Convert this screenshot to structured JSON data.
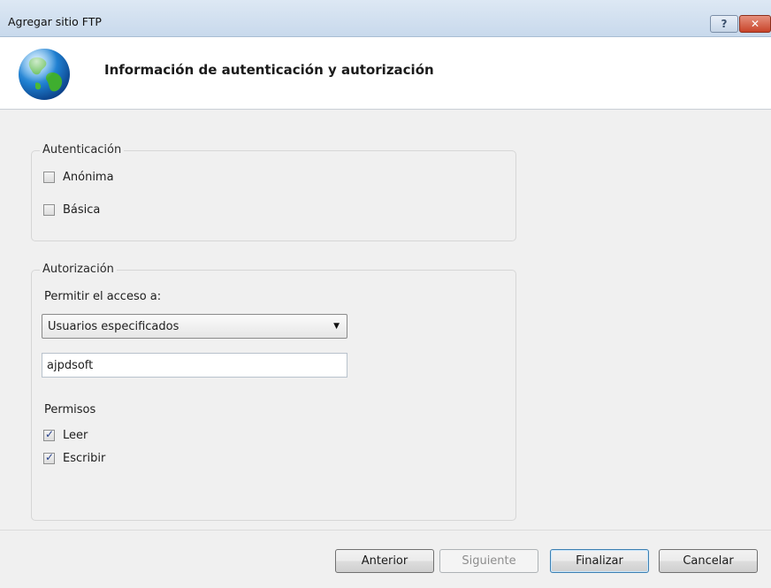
{
  "window": {
    "title": "Agregar sitio FTP",
    "help_label": "?",
    "close_label": "✕"
  },
  "header": {
    "title": "Información de autenticación y autorización",
    "icon": "globe-icon"
  },
  "authentication": {
    "legend": "Autenticación",
    "options": [
      {
        "label": "Anónima",
        "checked": false
      },
      {
        "label": "Básica",
        "checked": false
      }
    ]
  },
  "authorization": {
    "legend": "Autorización",
    "access_label": "Permitir el acceso a:",
    "access_selected": "Usuarios especificados",
    "users_value": "ajpdsoft",
    "permissions_label": "Permisos",
    "permissions": [
      {
        "label": "Leer",
        "checked": true
      },
      {
        "label": "Escribir",
        "checked": true
      }
    ]
  },
  "footer": {
    "previous_label": "Anterior",
    "next_label": "Siguiente",
    "finish_label": "Finalizar",
    "cancel_label": "Cancelar"
  }
}
